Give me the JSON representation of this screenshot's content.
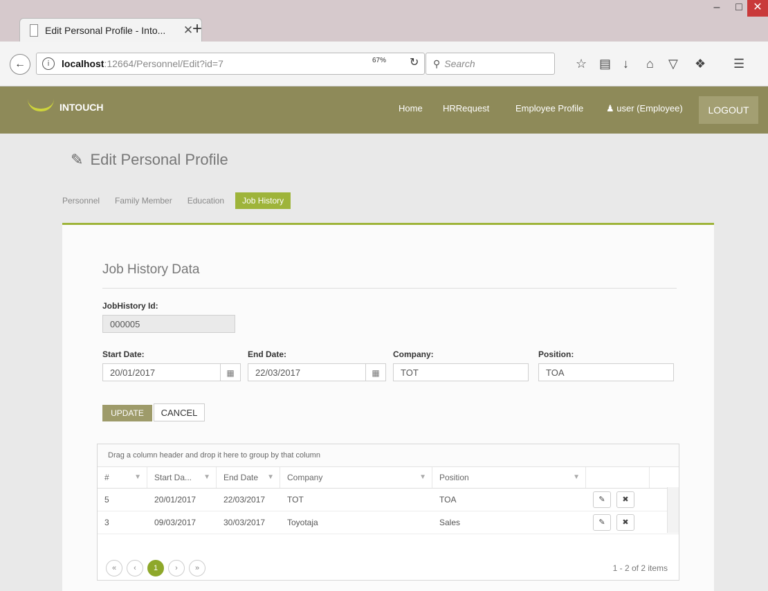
{
  "browser": {
    "tab_title": "Edit Personal Profile - Into...",
    "tab_close": "✕",
    "new_tab": "+",
    "url_host": "localhost",
    "url_path": ":12664/Personnel/Edit?id=7",
    "zoom": "67%",
    "search_placeholder": "Search"
  },
  "app": {
    "logo": "INTOUCH",
    "nav": [
      "Home",
      "HRRequest",
      "Employee Profile",
      "user (Employee)"
    ],
    "logout": "LOGOUT",
    "brand_color": "#8e8a59",
    "accent_color": "#9eb43a"
  },
  "page": {
    "title": "Edit Personal Profile",
    "tabs": [
      {
        "label": "Personnel",
        "active": false
      },
      {
        "label": "Family Member",
        "active": false
      },
      {
        "label": "Education",
        "active": false
      },
      {
        "label": "Job History",
        "active": true
      }
    ]
  },
  "form": {
    "section_title": "Job History Data",
    "id_label": "JobHistory Id:",
    "id_value": "000005",
    "start_label": "Start Date:",
    "start_value": "20/01/2017",
    "end_label": "End Date:",
    "end_value": "22/03/2017",
    "company_label": "Company:",
    "company_value": "TOT",
    "position_label": "Position:",
    "position_value": "TOA",
    "update_label": "UPDATE",
    "cancel_label": "CANCEL"
  },
  "grid": {
    "group_hint": "Drag a column header and drop it here to group by that column",
    "columns": [
      "#",
      "Start Da...",
      "End Date",
      "Company",
      "Position"
    ],
    "rows": [
      {
        "no": "5",
        "start": "20/01/2017",
        "end": "22/03/2017",
        "company": "TOT",
        "position": "TOA"
      },
      {
        "no": "3",
        "start": "09/03/2017",
        "end": "30/03/2017",
        "company": "Toyotaja",
        "position": "Sales"
      }
    ],
    "page": "1",
    "page_info": "1 - 2 of 2 items"
  }
}
